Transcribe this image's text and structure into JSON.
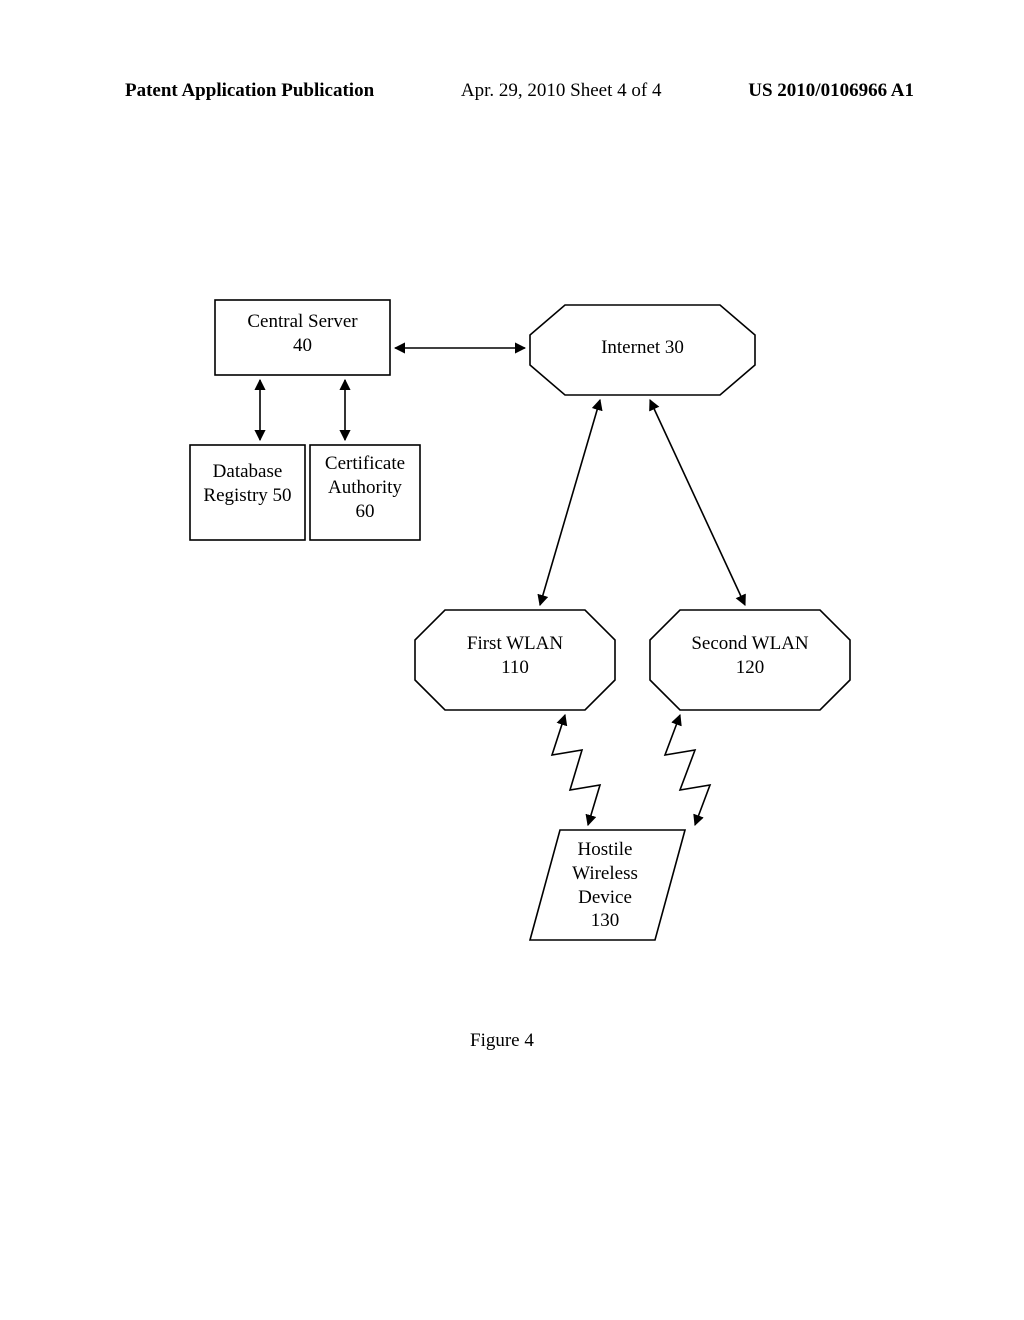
{
  "header": {
    "left": "Patent Application Publication",
    "center": "Apr. 29, 2010  Sheet 4 of 4",
    "right": "US 2010/0106966 A1"
  },
  "nodes": {
    "central_server": "Central Server\n40",
    "internet": "Internet 30",
    "database_registry": "Database\nRegistry 50",
    "certificate_authority": "Certificate\nAuthority\n60",
    "first_wlan": "First WLAN\n110",
    "second_wlan": "Second WLAN\n120",
    "hostile_device": "Hostile\nWireless\nDevice\n130"
  },
  "caption": "Figure 4"
}
